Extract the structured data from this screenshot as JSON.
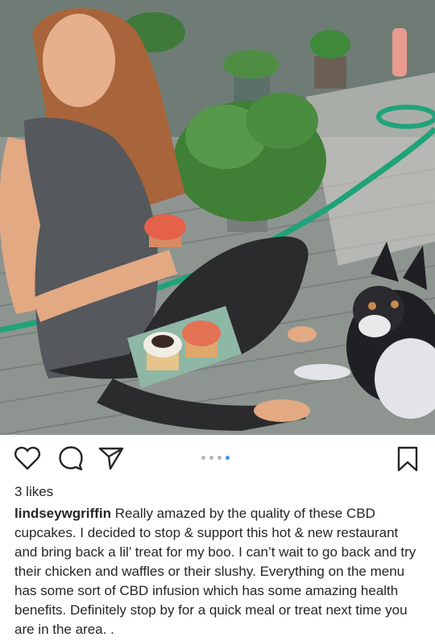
{
  "post": {
    "image_alt": "Woman sitting on a deck holding a cupcake, plate of cupcakes and a dog",
    "likes": "3 likes",
    "username": "lindseywgriffin",
    "caption": "Really amazed by the quality of these CBD cupcakes. I decided to stop & support this hot & new restaurant and bring back a lil’ treat for my boo. I can’t wait to go back and try their chicken and waffles or their slushy. Everything on the menu has some sort of CBD infusion which has some amazing health benefits. Definitely stop by for a quick meal or treat next time you are in the area. .",
    "carousel": {
      "total": 4,
      "active": 4
    }
  },
  "icons": {
    "like": "heart-icon",
    "comment": "comment-icon",
    "share": "share-icon",
    "save": "bookmark-icon"
  },
  "colors": {
    "accent": "#3897f0",
    "text": "#262626"
  }
}
